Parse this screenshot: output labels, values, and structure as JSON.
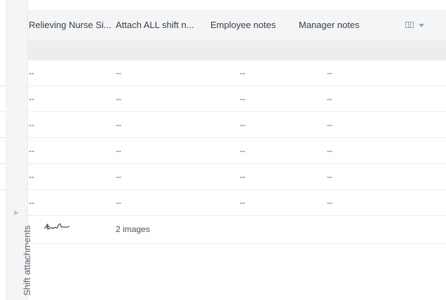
{
  "side_panel": {
    "label": "Shift attachments",
    "expand_arrow": "▶"
  },
  "header": {
    "columns": [
      "Relieving Nurse Si...",
      "Attach ALL shift n...",
      "Employee notes",
      "Manager notes"
    ],
    "settings_icon": "columns-icon",
    "caret_icon": "caret-down-icon"
  },
  "rows": [
    [
      "--",
      "--",
      "--",
      "--"
    ],
    [
      "--",
      "--",
      "--",
      "--"
    ],
    [
      "--",
      "--",
      "--",
      "--"
    ],
    [
      "--",
      "--",
      "--",
      "--"
    ],
    [
      "--",
      "--",
      "--",
      "--"
    ],
    [
      "--",
      "--",
      "--",
      "--"
    ]
  ],
  "image_row": {
    "signature_icon": "signature-thumbnail",
    "images_link": "2 images"
  }
}
